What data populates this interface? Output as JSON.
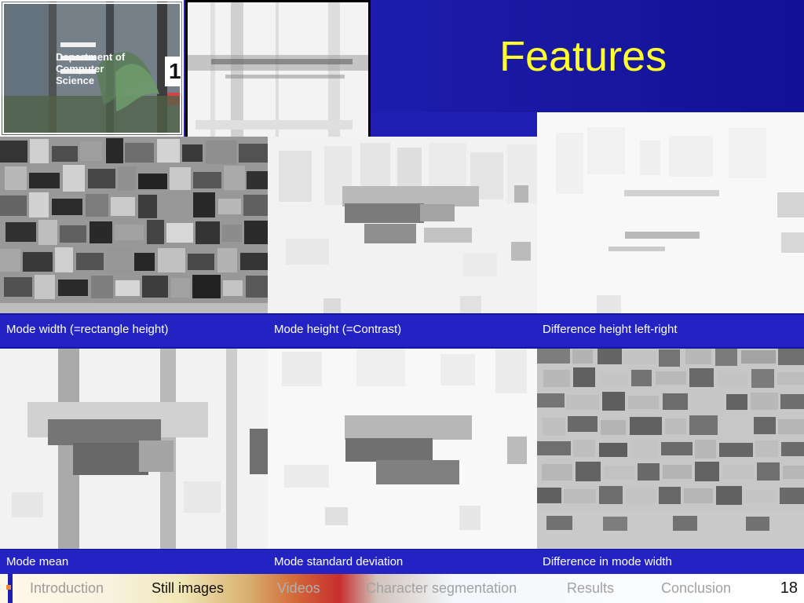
{
  "slide": {
    "title": "Features",
    "slide_number": "18",
    "thumbnail_sign": {
      "line1": "Department",
      "line2": "of",
      "line3": "Computer",
      "line4": "Science",
      "door_number": "1"
    }
  },
  "panels": [
    {
      "caption": "Mode width (=rectangle height)"
    },
    {
      "caption": "Mode height (=Contrast)"
    },
    {
      "caption": "Difference height left-right"
    },
    {
      "caption": "Mode mean"
    },
    {
      "caption": "Mode standard deviation"
    },
    {
      "caption": "Difference in mode width"
    }
  ],
  "navigation": {
    "items": [
      {
        "label": "Introduction",
        "color": "#9c9c9c"
      },
      {
        "label": "Still images",
        "color": "#111111"
      },
      {
        "label": "Videos",
        "color": "#b0b0b0"
      },
      {
        "label": "Character segmentation",
        "color": "#a2a2a2"
      },
      {
        "label": "Results",
        "color": "#a2a2a2"
      },
      {
        "label": "Conclusion",
        "color": "#a2a2a2"
      }
    ]
  },
  "colors": {
    "background": "#1f1fb4",
    "title": "#ffff2a",
    "caption_band": "#2323c4",
    "caption_text": "#ffffff"
  }
}
